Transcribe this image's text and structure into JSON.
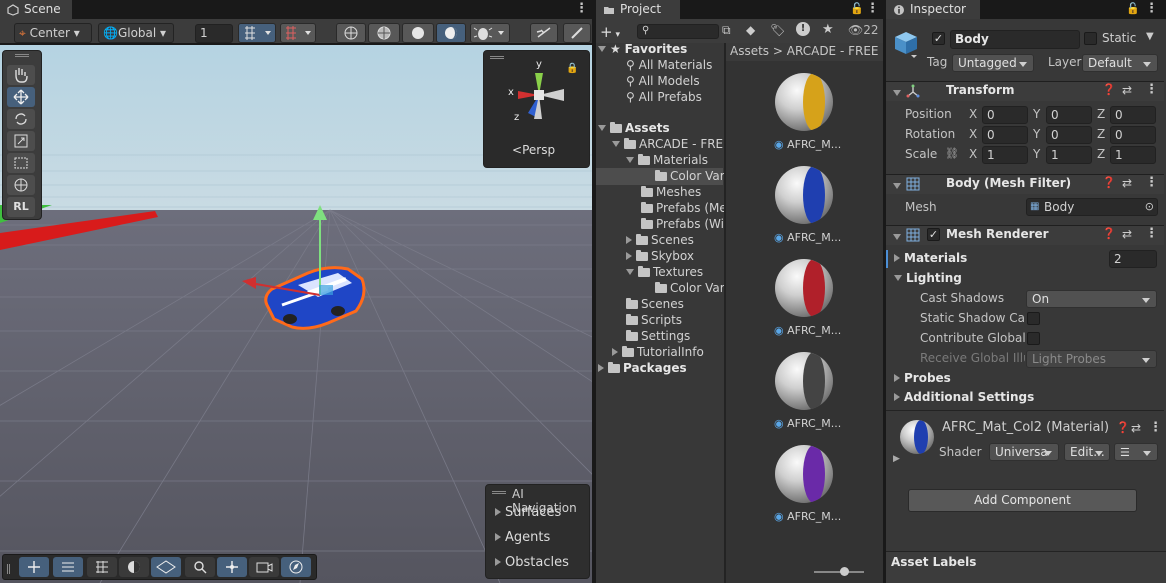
{
  "scene": {
    "tab": "Scene",
    "pivot": "Center",
    "space": "Global",
    "grid_step": "1",
    "gizmo_persp": "Persp",
    "rl_label": "RL",
    "ai_nav": {
      "title": "AI Navigation",
      "items": [
        "Surfaces",
        "Agents",
        "Obstacles"
      ]
    }
  },
  "project": {
    "tab": "Project",
    "count": "22",
    "breadcrumb_root": "Assets",
    "breadcrumb_sep": ">",
    "breadcrumb_child": "ARCADE - FREE R",
    "favorites": {
      "label": "Favorites",
      "items": [
        "All Materials",
        "All Models",
        "All Prefabs"
      ]
    },
    "tree": {
      "assets": "Assets",
      "arcade": "ARCADE - FRE",
      "materials": "Materials",
      "color_var_1": "Color Var",
      "meshes": "Meshes",
      "prefabs_me": "Prefabs (Me",
      "prefabs_wi": "Prefabs (Wi",
      "scenes_inner": "Scenes",
      "skybox": "Skybox",
      "textures": "Textures",
      "color_var_2": "Color Var",
      "scenes": "Scenes",
      "scripts": "Scripts",
      "settings": "Settings",
      "tutorialinfo": "TutorialInfo",
      "packages": "Packages"
    },
    "assets": [
      {
        "label": "AFRC_M...",
        "color": "#d6a21a"
      },
      {
        "label": "AFRC_M...",
        "color": "#1f3fb0"
      },
      {
        "label": "AFRC_M...",
        "color": "#b0202a"
      },
      {
        "label": "AFRC_M...",
        "color": "#444444"
      },
      {
        "label": "AFRC_M...",
        "color": "#6a2aa8"
      }
    ]
  },
  "inspector": {
    "tab": "Inspector",
    "object_name": "Body",
    "static_label": "Static",
    "tag_label": "Tag",
    "tag_value": "Untagged",
    "layer_label": "Layer",
    "layer_value": "Default",
    "transform": {
      "title": "Transform",
      "position": "Position",
      "rotation": "Rotation",
      "scale": "Scale",
      "pos": [
        "0",
        "0",
        "0"
      ],
      "rot": [
        "0",
        "0",
        "0"
      ],
      "scl": [
        "1",
        "1",
        "1"
      ],
      "x": "X",
      "y": "Y",
      "z": "Z"
    },
    "mesh_filter": {
      "title": "Body (Mesh Filter)",
      "mesh_label": "Mesh",
      "mesh_value": "Body"
    },
    "mesh_renderer": {
      "title": "Mesh Renderer",
      "materials_label": "Materials",
      "materials_count": "2",
      "lighting": "Lighting",
      "cast_shadows": "Cast Shadows",
      "cast_shadows_value": "On",
      "static_shadow": "Static Shadow Cas",
      "contribute_gi": "Contribute Global",
      "receive_gi": "Receive Global Illu",
      "receive_gi_value": "Light Probes",
      "probes": "Probes",
      "additional": "Additional Settings"
    },
    "material": {
      "title": "AFRC_Mat_Col2 (Material)",
      "shader_label": "Shader",
      "shader_value": "Universa",
      "edit_label": "Edit..."
    },
    "add_component": "Add Component",
    "asset_labels": "Asset Labels"
  }
}
